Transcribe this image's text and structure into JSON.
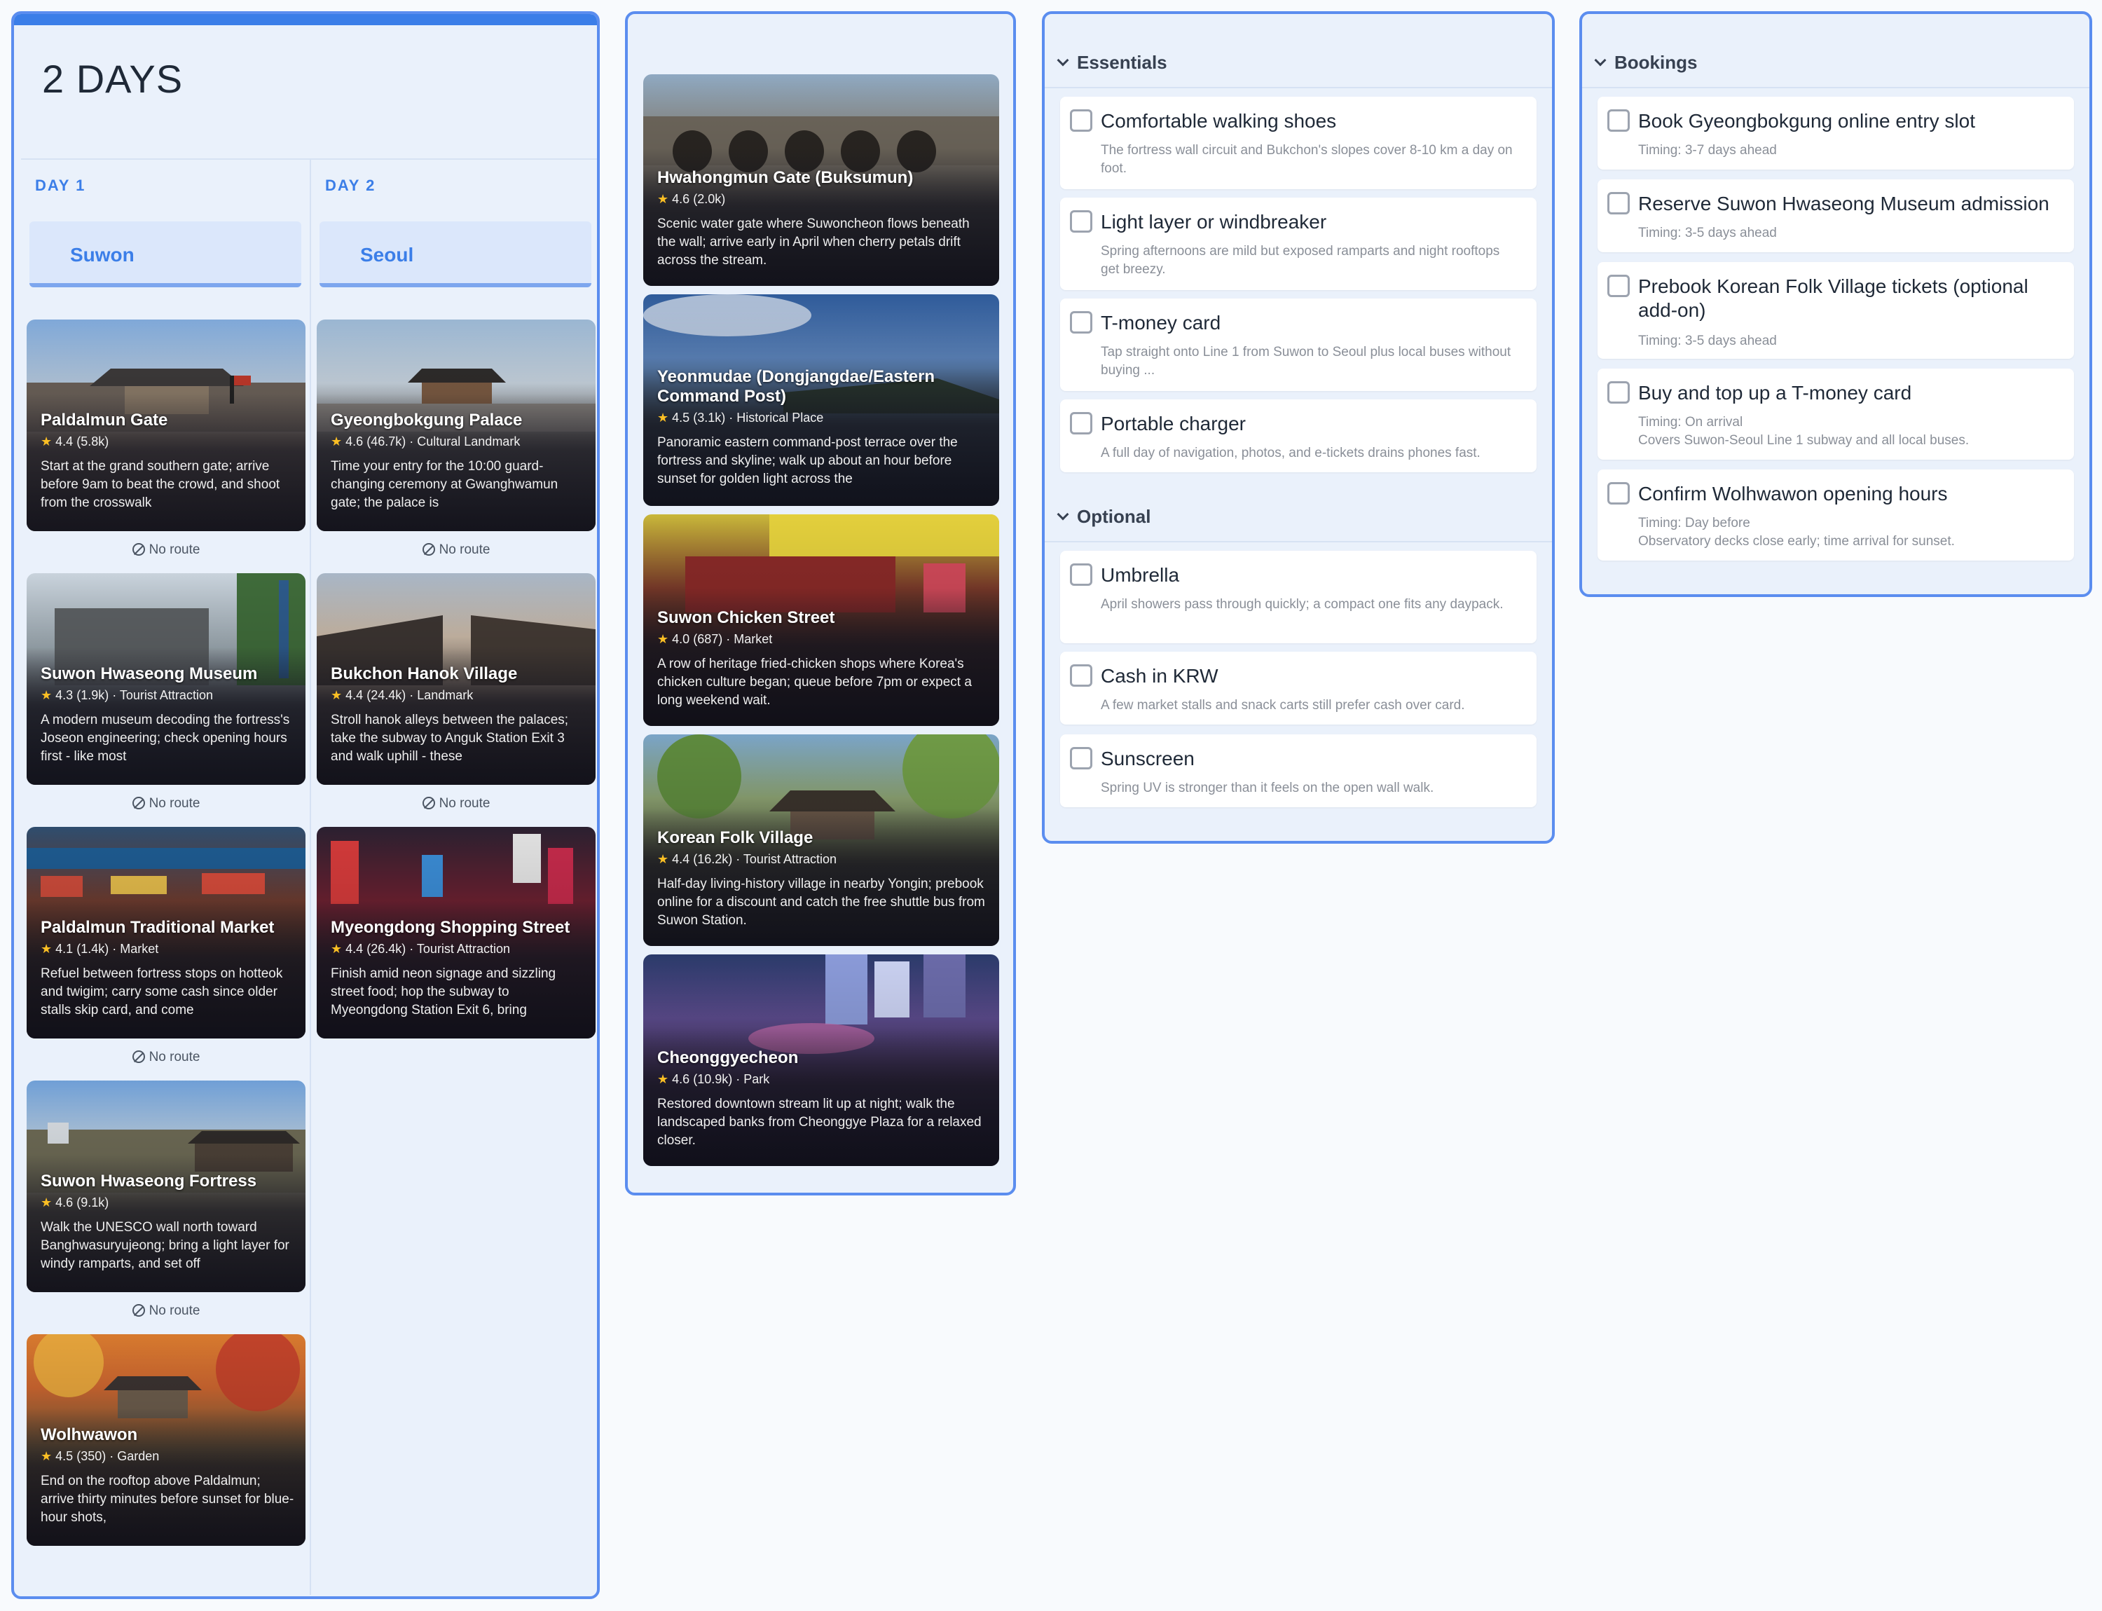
{
  "itinerary": {
    "title": "2 DAYS",
    "days": [
      {
        "label": "DAY 1",
        "city": "Suwon",
        "stops": [
          {
            "name": "Paldalmun Gate",
            "rating": "4.4",
            "reviews": "(5.8k)",
            "category": "",
            "desc": "Start at the grand southern gate; arrive before 9am to beat the crowd, and shoot from the crosswalk",
            "route": "No route"
          },
          {
            "name": "Suwon Hwaseong Museum",
            "rating": "4.3",
            "reviews": "(1.9k)",
            "category": "· Tourist Attraction",
            "desc": "A modern museum decoding the fortress's Joseon engineering; check opening hours first - like most",
            "route": "No route"
          },
          {
            "name": "Paldalmun Traditional Market",
            "rating": "4.1",
            "reviews": "(1.4k)",
            "category": "· Market",
            "desc": "Refuel between fortress stops on hotteok and twigim; carry some cash since older stalls skip card, and come",
            "route": "No route"
          },
          {
            "name": "Suwon Hwaseong Fortress",
            "rating": "4.6",
            "reviews": "(9.1k)",
            "category": "",
            "desc": "Walk the UNESCO wall north toward Banghwasuryujeong; bring a light layer for windy ramparts, and set off",
            "route": "No route"
          },
          {
            "name": "Wolhwawon",
            "rating": "4.5",
            "reviews": "(350)",
            "category": "· Garden",
            "desc": "End on the rooftop above Paldalmun; arrive thirty minutes before sunset for blue-hour shots,",
            "route": ""
          }
        ]
      },
      {
        "label": "DAY 2",
        "city": "Seoul",
        "stops": [
          {
            "name": "Gyeongbokgung Palace",
            "rating": "4.6",
            "reviews": "(46.7k)",
            "category": "· Cultural Landmark",
            "desc": "Time your entry for the 10:00 guard-changing ceremony at Gwanghwamun gate; the palace is",
            "route": "No route"
          },
          {
            "name": "Bukchon Hanok Village",
            "rating": "4.4",
            "reviews": "(24.4k)",
            "category": "· Landmark",
            "desc": "Stroll hanok alleys between the palaces; take the subway to Anguk Station Exit 3 and walk uphill - these",
            "route": "No route"
          },
          {
            "name": "Myeongdong Shopping Street",
            "rating": "4.4",
            "reviews": "(26.4k)",
            "category": "· Tourist Attraction",
            "desc": "Finish amid neon signage and sizzling street food; hop the subway to Myeongdong Station Exit 6, bring",
            "route": ""
          }
        ]
      }
    ]
  },
  "pool": [
    {
      "name": "Hwahongmun Gate (Buksumun)",
      "rating": "4.6",
      "reviews": "(2.0k)",
      "category": "",
      "desc": "Scenic water gate where Suwoncheon flows beneath the wall; arrive early in April when cherry petals drift across the stream."
    },
    {
      "name": "Yeonmudae (Dongjangdae/Eastern Command Post)",
      "rating": "4.5",
      "reviews": "(3.1k)",
      "category": "· Historical Place",
      "desc": "Panoramic eastern command-post terrace over the fortress and skyline; walk up about an hour before sunset for golden light across the"
    },
    {
      "name": "Suwon Chicken Street",
      "rating": "4.0",
      "reviews": "(687)",
      "category": "· Market",
      "desc": "A row of heritage fried-chicken shops where Korea's chicken culture began; queue before 7pm or expect a long weekend wait."
    },
    {
      "name": "Korean Folk Village",
      "rating": "4.4",
      "reviews": "(16.2k)",
      "category": "· Tourist Attraction",
      "desc": "Half-day living-history village in nearby Yongin; prebook online for a discount and catch the free shuttle bus from Suwon Station."
    },
    {
      "name": "Cheonggyecheon",
      "rating": "4.6",
      "reviews": "(10.9k)",
      "category": "· Park",
      "desc": "Restored downtown stream lit up at night; walk the landscaped banks from Cheonggye Plaza for a relaxed closer."
    }
  ],
  "essentials": {
    "title": "Essentials",
    "items": [
      {
        "label": "Comfortable walking shoes",
        "sub": "The fortress wall circuit and Bukchon's slopes cover 8-10 km a day on foot."
      },
      {
        "label": "Light layer or windbreaker",
        "sub": "Spring afternoons are mild but exposed ramparts and night rooftops get breezy."
      },
      {
        "label": "T-money card",
        "sub": "Tap straight onto Line 1 from Suwon to Seoul plus local buses without buying  ..."
      },
      {
        "label": "Portable charger",
        "sub": "A full day of navigation, photos, and e-tickets drains phones fast."
      }
    ]
  },
  "optional": {
    "title": "Optional",
    "items": [
      {
        "label": "Umbrella",
        "sub": "April showers pass through quickly; a compact one fits any daypack."
      },
      {
        "label": "Cash in KRW",
        "sub": "A few market stalls and snack carts still prefer cash over card."
      },
      {
        "label": "Sunscreen",
        "sub": "Spring UV is stronger than it feels on the open wall walk."
      }
    ]
  },
  "bookings": {
    "title": "Bookings",
    "items": [
      {
        "label": "Book Gyeongbokgung online entry slot",
        "timing": "Timing: 3-7 days ahead",
        "note": ""
      },
      {
        "label": "Reserve Suwon Hwaseong Museum admission",
        "timing": "Timing: 3-5 days ahead",
        "note": ""
      },
      {
        "label": "Prebook Korean Folk Village tickets (optional add-on)",
        "timing": "Timing: 3-5 days ahead",
        "note": ""
      },
      {
        "label": "Buy and top up a T-money card",
        "timing": "Timing: On arrival",
        "note": "Covers Suwon-Seoul Line 1 subway and all local buses."
      },
      {
        "label": "Confirm Wolhwawon opening hours",
        "timing": "Timing: Day before",
        "note": "Observatory decks close early; time arrival for sunset."
      }
    ]
  }
}
